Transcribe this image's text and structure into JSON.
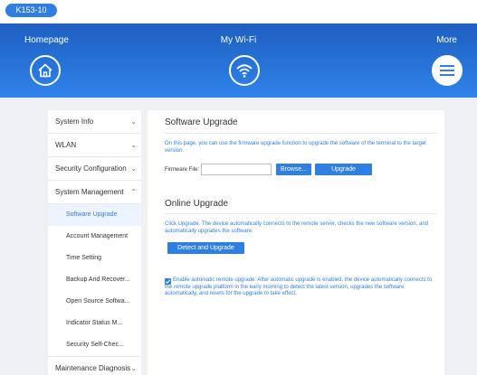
{
  "device": {
    "model": "K153-10"
  },
  "nav": {
    "home_label": "Homepage",
    "wifi_label": "My Wi-Fi",
    "more_label": "More"
  },
  "sidebar": {
    "items": [
      {
        "label": "System Info",
        "chevron": "⌄"
      },
      {
        "label": "WLAN",
        "chevron": "⌄"
      },
      {
        "label": "Security Configuration",
        "chevron": "⌄"
      },
      {
        "label": "System Management",
        "chevron": "⌃"
      }
    ],
    "subitems": [
      {
        "label": "Software Upgrade",
        "active": true
      },
      {
        "label": "Account Management"
      },
      {
        "label": "Time Setting"
      },
      {
        "label": "Backup And Recover..."
      },
      {
        "label": "Open Source Softwa..."
      },
      {
        "label": "Indicator Status M..."
      },
      {
        "label": "Security Self-Chec..."
      }
    ],
    "footer_item": {
      "label": "Maintenance Diagnosis",
      "chevron": "⌄"
    }
  },
  "main": {
    "software_upgrade": {
      "title": "Software Upgrade",
      "description": "On this page, you can use the firmware upgrade function to upgrade the software of the terminal to the target version.",
      "firmware_label": "Firmware File:",
      "firmware_value": "",
      "browse_label": "Browse...",
      "upgrade_label": "Upgrade"
    },
    "online_upgrade": {
      "title": "Online Upgrade",
      "description": "Click Upgrade. The device automatically connects to the remote server, checks the new software version, and automatically upgrades the software.",
      "detect_label": "Detect and Upgrade",
      "auto_text": "Enable automatic remote upgrade. After automatic upgrade is enabled, the device automatically connects to the remote upgrade platform in the early morning to detect the latest version, upgrades the software automatically, and resets for the upgrade to take effect.",
      "auto_checked": true
    }
  },
  "colors": {
    "accent": "#2f7fe2",
    "header_top": "#1d5fc0",
    "header_bottom": "#2f83ea"
  }
}
